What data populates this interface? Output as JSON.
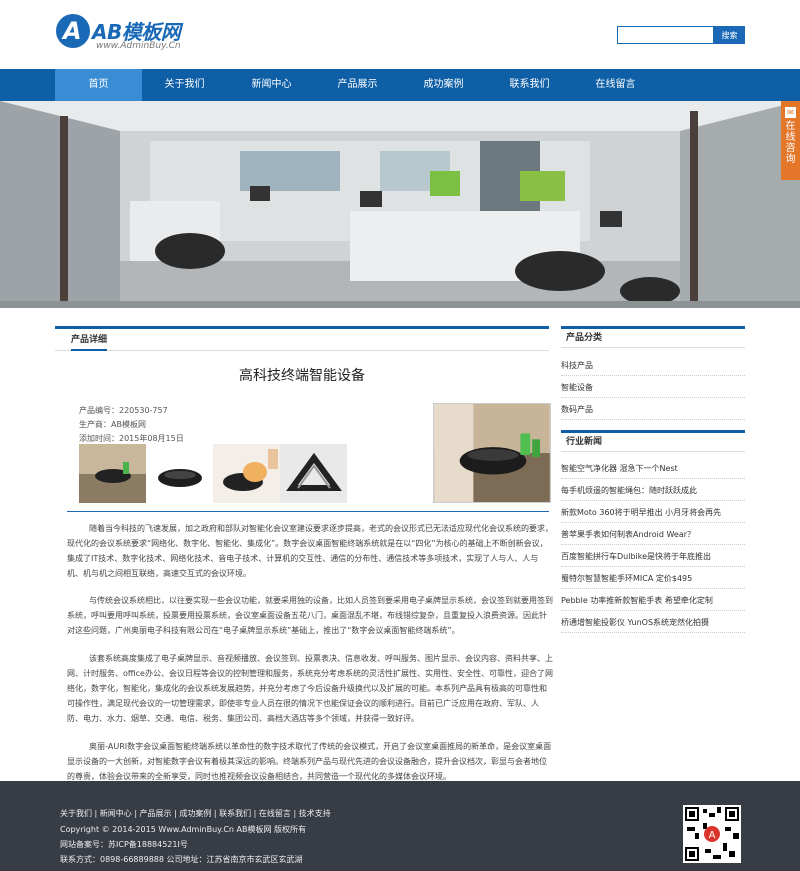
{
  "header": {
    "logo_text": "AB模板网",
    "logo_sub": "www.AdminBuy.Cn",
    "search_placeholder": "",
    "search_button": "搜索"
  },
  "nav": {
    "items": [
      {
        "label": "首页",
        "active": true
      },
      {
        "label": "关于我们",
        "active": false
      },
      {
        "label": "新闻中心",
        "active": false
      },
      {
        "label": "产品展示",
        "active": false
      },
      {
        "label": "成功案例",
        "active": false
      },
      {
        "label": "联系我们",
        "active": false
      },
      {
        "label": "在线留言",
        "active": false
      }
    ]
  },
  "side_tab": {
    "label": "在线咨询"
  },
  "main": {
    "panel_title": "产品详细",
    "product_title": "高科技终端智能设备",
    "meta": [
      "产品编号：220530-757",
      "生产商：AB模板网",
      "添加时间：2015年08月15日"
    ],
    "paragraphs": [
      "随着当今科技的飞速发展，加之政府和部队对智能化会议室建设要求逐步提高，老式的会议形式已无法适应现代化会议系统的要求，现代化的会议系统要求“网络化、数字化、智能化、集成化”。数字会议桌面智能终端系统就是在以“四化”为核心的基础上不断创新会议，集成了IT技术、数字化技术、网络化技术、音电子技术、计算机的交互性、通信的分布性、通信技术等多项技术，实现了人与人、人与机、机与机之间相互联络，高速交互式的会议环境。",
      "与传统会议系统相比，以往要实现一些会议功能，就要采用独的设备，比如人员签到要采用电子桌牌显示系统，会议签到就要用签到系统，呼叫要用呼叫系统，投票要用投票系统，会议室桌面设备五花八门，桌面混乱不堪，布线错综复杂，且重复投入浪费资源。因此针对这些问题，广州奥丽电子科技有限公司在“电子桌牌显示系统”基础上，推出了“数字会议桌面智能终端系统”。",
      "该套系统高度集成了电子桌牌显示、音视频播放、会议签到、投票表决、信息收发、呼叫服务、图片显示、会议内容、资料共享、上网、计时服务、office办公、会议日程等会议的控制管理和服务，系统充分考虑系统的灵活性扩展性、实用性、安全性、可靠性，迎合了网络化，数字化，智能化，集成化的会议系统发展趋势，并充分考虑了今后设备升级换代以及扩展的可能。本系列产品具有极高的可靠性和可操作性，满足现代会议的一切管理需求，即使非专业人员在很的情况下也能保证会议的顺利进行。目前已广泛应用在政府、军队、人防、电力、水力、烟草、交通、电信、税务、集团公司、高档大酒店等多个领域，并获得一致好评。",
      "奥丽-AURI数字会议桌面智能终端系统以革命性的数字技术取代了传统的会议模式，开启了会议室桌面推局的新革命，是会议室桌面显示设备的一大创新，对智能数字会议有着极其深远的影响。终端系列产品与现代先进的会议设备融合，提升会议档次，彰显与会者地位的尊贵，体验会议带来的全新享受，同时也推视频会议设备相结合，共同营造一个现代化的多媒体会议环境。"
    ]
  },
  "sidebar": {
    "cat_title": "产品分类",
    "categories": [
      "科技产品",
      "智能设备",
      "数码产品"
    ],
    "news_title": "行业新闻",
    "news": [
      "智能空气净化器 湿急下一个Nest",
      "每手机烦遥的智能绳包：随时跃跃成此",
      "新款Moto 360将于明早推出 小月牙将会再先",
      "普苹果手表如何制表Android Wear？",
      "百度智能拼行车Dulbike是快将于年底推出",
      "蜀特尔智慧智能手环MICA 定价$495",
      "Pebble 功率推新款智能手表 希望牵化定制",
      "桥通增智能投影仪 YunOS系统宠然化拍摄"
    ]
  },
  "footer": {
    "links": "关于我们 | 新闻中心 | 产品展示 | 成功案例 | 联系我们 | 在线留言 | 技术支持",
    "copyright": "Copyright © 2014-2015 Www.AdminBuy.Cn AB模板网 版权所有",
    "icp": "网站备案号：苏ICP备18884521I号",
    "contact": "联系方式：0898-66889888 公司地址：江苏省南京市玄武区玄武湖"
  },
  "colors": {
    "brand": "#0f5fa6",
    "accent": "#f08a1e",
    "footer": "#383d45"
  }
}
